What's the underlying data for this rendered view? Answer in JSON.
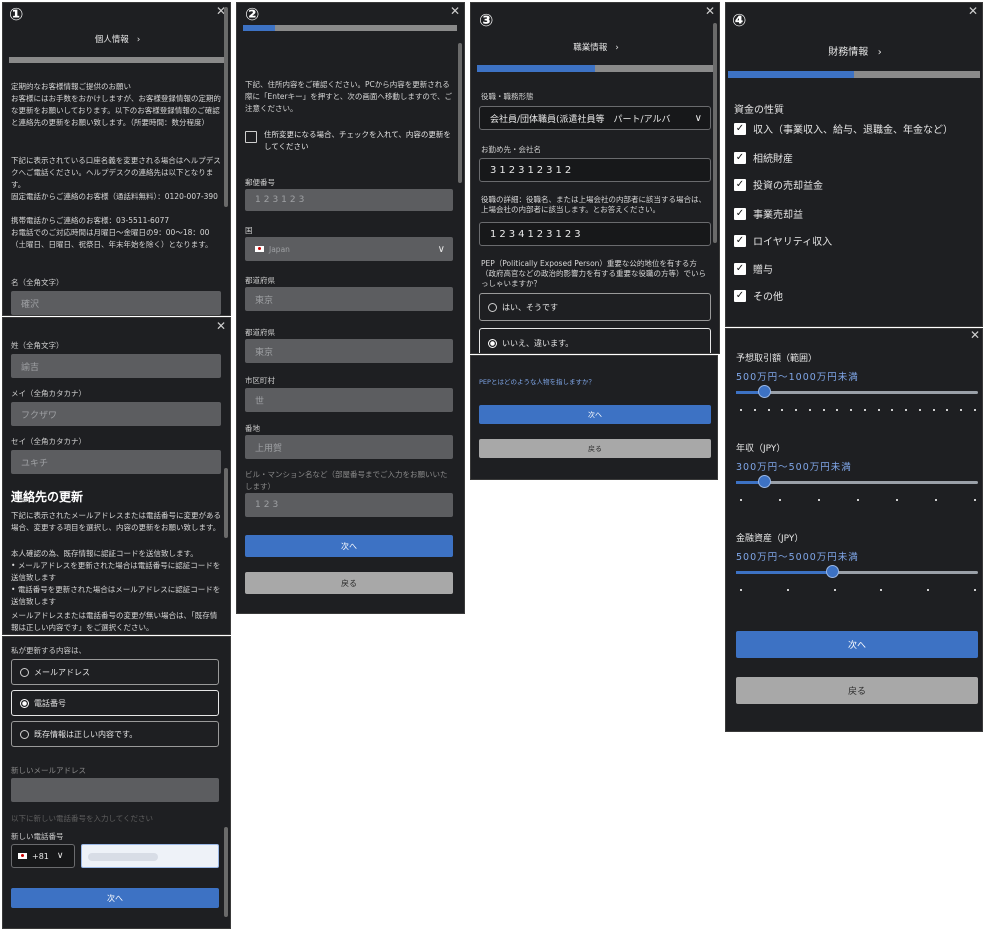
{
  "panel1": {
    "number": "①",
    "header": "個人情報",
    "chevron": "›",
    "intro": [
      "定期的なお客様情報ご提供のお願い",
      "お客様にはお手数をおかけしますが、お客様登録情報の定期的な更新をお願いしております。以下のお客様登録情報のご確認と連絡先の更新をお願い致します。（所要時間：数分程度）"
    ],
    "helpdesk": "下記に表示されている口座名義を変更される場合はヘルプデスクへご電話ください。ヘルプデスクの連絡先は以下となります。",
    "fixed_line": "固定電話からご連絡のお客様（通話料無料）：0120-007-390",
    "mobile_line": "携帯電話からご連絡のお客様：03-5511-6077",
    "hours": "お電話でのご対応時間は月曜日～金曜日の9：00～18：00（土曜日、日曜日、祝祭日、年末年始を除く）となります。",
    "first_name_label": "名（全角文字）",
    "first_name_value": "確沢"
  },
  "panel2": {
    "last_name_label": "姓（全角文字）",
    "last_name_value": "諭吉",
    "mei_kana_label": "メイ（全角カタカナ）",
    "mei_kana_value": "フクザワ",
    "sei_kana_label": "セイ（全角カタカナ）",
    "sei_kana_value": "ユキチ",
    "contact_heading": "連絡先の更新",
    "contact_desc": "下記に表示されたメールアドレスまたは電話番号に変更がある場合、変更する項目を選択し、内容の更新をお願い致します。",
    "auth_note": "本人確認の為、既存情報に認証コードを送信致します。",
    "bullets": [
      "メールアドレスを更新された場合は電話番号に認証コードを送信致します",
      "電話番号を更新された場合はメールアドレスに認証コードを送信致します"
    ],
    "no_change_note": "メールアドレスまたは電話番号の変更が無い場合は、「既存情報は正しい内容です」をご選択ください。"
  },
  "panel3": {
    "update_label": "私が更新する内容は、",
    "option_email": "メールアドレス",
    "option_phone": "電話番号",
    "option_existing": "既存情報は正しい内容です。",
    "new_email_label": "新しいメールアドレス",
    "hint": "以下に新しい電話番号を入力してください",
    "new_phone_label": "新しい電話番号",
    "country_code": "+81",
    "next": "次へ"
  },
  "panel4": {
    "number": "②",
    "instructions": "下記、住所内容をご確認ください。PCから内容を更新される際に「Enterキー」を押すと、次の画面へ移動しますので、ご注意ください。",
    "checkbox_label": "住所変更になる場合、チェックを入れて、内容の更新をしてください",
    "postal_label": "郵便番号",
    "postal_value": "123123",
    "country_label": "国",
    "country_value": "Japan",
    "prefecture_label": "都道府県",
    "prefecture_value": "東京",
    "prefecture2_label": "都道府県",
    "prefecture2_value": "東京",
    "city_label": "市区町村",
    "city_value": "世",
    "street_label": "番地",
    "street_value": "上用賀",
    "building_label": "ビル・マンション名など（部屋番号までご入力をお願いいたします）",
    "building_value": "123",
    "next": "次へ",
    "back": "戻る",
    "progress": 0.15
  },
  "panel5": {
    "number": "③",
    "header": "職業情報",
    "chevron": "›",
    "position_label": "役職・職務形態",
    "position_value": "会社員/団体職員(派遣社員等　パート/アルバ",
    "employer_label": "お勤め先・会社名",
    "employer_value": "312312312",
    "detail_label": "役職の詳細：役職名、または上場会社の内部者に該当する場合は、上場会社の内部者に該当します。とお答えください。",
    "detail_value": "1234123123",
    "pep_label": "PEP（Politically Exposed Person）重要な公的地位を有する方（政府高官などの政治的影響力を有する重要な役職の方等）でいらっしゃいますか？",
    "pep_yes": "はい、そうです",
    "pep_no": "いいえ、違います。",
    "progress": 0.5
  },
  "panel6": {
    "pep_link": "PEPとはどのような人物を指しますか？",
    "next": "次へ",
    "back": "戻る"
  },
  "panel7": {
    "number": "④",
    "header": "財務情報",
    "chevron": "›",
    "source_label": "資金の性質",
    "sources": [
      "収入（事業収入、給与、退職金、年金など）",
      "相続財産",
      "投資の売却益金",
      "事業売却益",
      "ロイヤリティ収入",
      "贈与",
      "その他"
    ],
    "progress": 0.5
  },
  "panel8": {
    "trade_label": "予想取引額（範囲）",
    "trade_value": "500万円～1000万円未満",
    "trade_pos": 0.12,
    "income_label": "年収（JPY）",
    "income_value": "300万円～500万円未満",
    "income_pos": 0.12,
    "assets_label": "金融資産（JPY）",
    "assets_value": "500万円～5000万円未満",
    "assets_pos": 0.4,
    "next": "次へ",
    "back": "戻る"
  },
  "colors": {
    "accent": "#3d72c4",
    "panel_bg": "#1e1f22"
  }
}
